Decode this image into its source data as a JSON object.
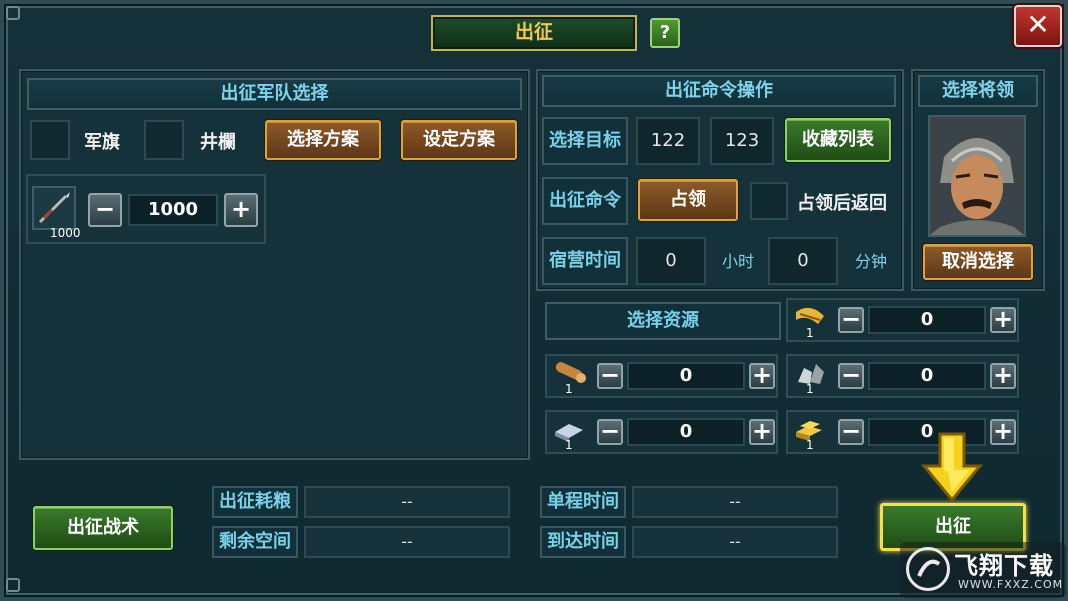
{
  "title": "出征",
  "help_label": "?",
  "close_label": "✕",
  "army": {
    "header": "出征军队选择",
    "flag_label": "军旗",
    "barrier_label": "井欄",
    "select_plan": "选择方案",
    "set_plan": "设定方案",
    "unit_count": "1000",
    "unit_amount": "1000"
  },
  "command": {
    "header": "出征命令操作",
    "target_label": "选择目标",
    "target_x": "122",
    "target_y": "123",
    "favorites": "收藏列表",
    "order_label": "出征命令",
    "order_value": "占领",
    "return_label": "占领后返回",
    "camp_label": "宿营时间",
    "hours_value": "0",
    "hours_unit": "小时",
    "minutes_value": "0",
    "minutes_unit": "分钟"
  },
  "general": {
    "header": "选择将领",
    "cancel": "取消选择"
  },
  "resources": {
    "header": "选择资源",
    "items": [
      {
        "name": "food",
        "count": "1",
        "value": "0"
      },
      {
        "name": "wood",
        "count": "1",
        "value": "0"
      },
      {
        "name": "stone",
        "count": "1",
        "value": "0"
      },
      {
        "name": "iron",
        "count": "1",
        "value": "0"
      },
      {
        "name": "gold",
        "count": "1",
        "value": "0"
      }
    ]
  },
  "bottom": {
    "tactics": "出征战术",
    "food_cost_label": "出征耗粮",
    "food_cost_value": "--",
    "space_label": "剩余空间",
    "space_value": "--",
    "oneway_label": "单程时间",
    "oneway_value": "--",
    "arrive_label": "到达时间",
    "arrive_value": "--",
    "march": "出征"
  },
  "watermark": {
    "text": "飞翔下载",
    "url": "WWW.FXXZ.COM"
  },
  "colors": {
    "accent_cyan": "#7fd3ea",
    "title_gold": "#f2c94c",
    "arrow_yellow": "#f5d21c"
  }
}
